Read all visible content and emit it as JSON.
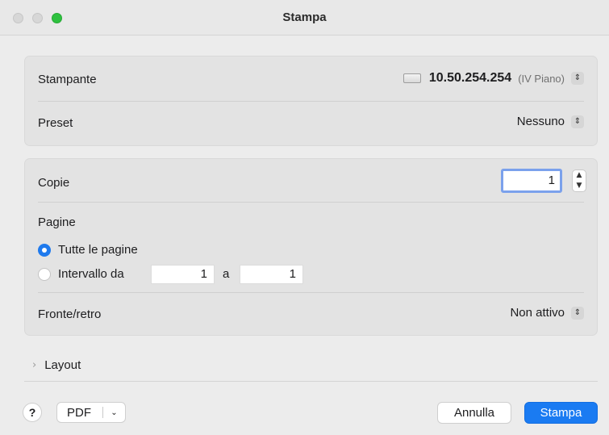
{
  "window": {
    "title": "Stampa"
  },
  "printer": {
    "label": "Stampante",
    "name": "10.50.254.254",
    "location": "(IV Piano)"
  },
  "preset": {
    "label": "Preset",
    "value": "Nessuno"
  },
  "copies": {
    "label": "Copie",
    "value": "1"
  },
  "pages": {
    "label": "Pagine",
    "all_label": "Tutte le pagine",
    "range_label": "Intervallo da",
    "range_from": "1",
    "range_to_label": "a",
    "range_to": "1",
    "selected": "all"
  },
  "duplex": {
    "label": "Fronte/retro",
    "value": "Non attivo"
  },
  "layout": {
    "label": "Layout"
  },
  "footer": {
    "help_label": "?",
    "pdf_label": "PDF",
    "cancel_label": "Annulla",
    "print_label": "Stampa"
  },
  "colors": {
    "accent": "#1a7bf2",
    "traffic_green": "#2ec13f"
  }
}
